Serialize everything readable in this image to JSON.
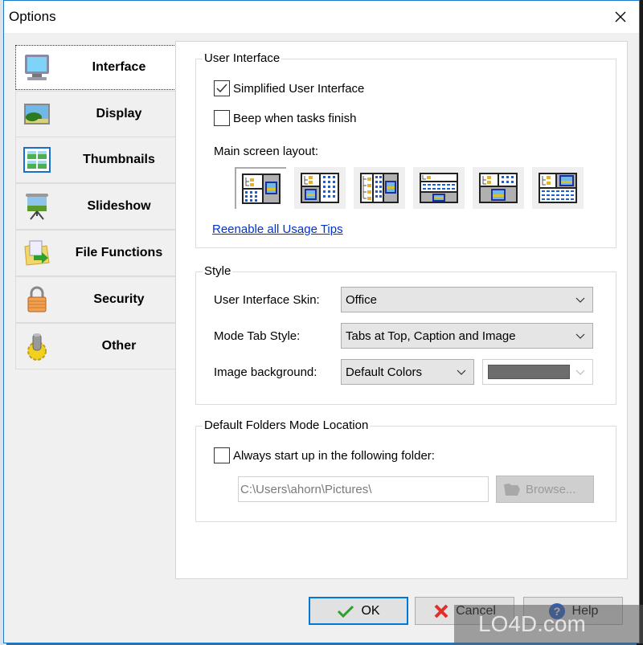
{
  "window": {
    "title": "Options",
    "close_icon": "close-icon"
  },
  "sidebar": {
    "items": [
      {
        "label": "Interface",
        "icon": "monitor-icon",
        "active": true
      },
      {
        "label": "Display",
        "icon": "landscape-picture-icon",
        "active": false
      },
      {
        "label": "Thumbnails",
        "icon": "thumbnails-grid-icon",
        "active": false
      },
      {
        "label": "Slideshow",
        "icon": "projector-screen-icon",
        "active": false
      },
      {
        "label": "File Functions",
        "icon": "folder-arrow-icon",
        "active": false
      },
      {
        "label": "Security",
        "icon": "padlock-icon",
        "active": false
      },
      {
        "label": "Other",
        "icon": "gear-cylinder-icon",
        "active": false
      }
    ]
  },
  "user_interface": {
    "title": "User Interface",
    "simplified_ui": {
      "label": "Simplified User Interface",
      "checked": true
    },
    "beep": {
      "label": "Beep when tasks finish",
      "checked": false
    },
    "layout_label": "Main screen layout:",
    "layouts": [
      {
        "name": "layout-tree-thumbs-left-preview-right",
        "selected": true
      },
      {
        "name": "layout-tree-preview-left-thumbs-right",
        "selected": false
      },
      {
        "name": "layout-tree-thumbs-preview-columns",
        "selected": false
      },
      {
        "name": "layout-tree-top-thumbs-middle-preview-bottom",
        "selected": false
      },
      {
        "name": "layout-tree-thumbs-top-preview-bottom",
        "selected": false
      },
      {
        "name": "layout-tree-preview-top-thumbs-bottom",
        "selected": false
      }
    ],
    "reenable_link": "Reenable all Usage Tips"
  },
  "style": {
    "title": "Style",
    "skin_label": "User Interface Skin:",
    "skin_value": "Office",
    "tab_style_label": "Mode Tab Style:",
    "tab_style_value": "Tabs at Top, Caption and Image",
    "bg_label": "Image background:",
    "bg_value": "Default Colors",
    "bg_color": "#6d6d6d"
  },
  "folders": {
    "title": "Default Folders Mode Location",
    "always_start": {
      "label": "Always start up in the following folder:",
      "checked": false
    },
    "path_value": "C:\\Users\\ahorn\\Pictures\\",
    "browse_label": "Browse..."
  },
  "buttons": {
    "ok": "OK",
    "cancel": "Cancel",
    "help": "Help"
  },
  "watermark": "LO4D.com"
}
